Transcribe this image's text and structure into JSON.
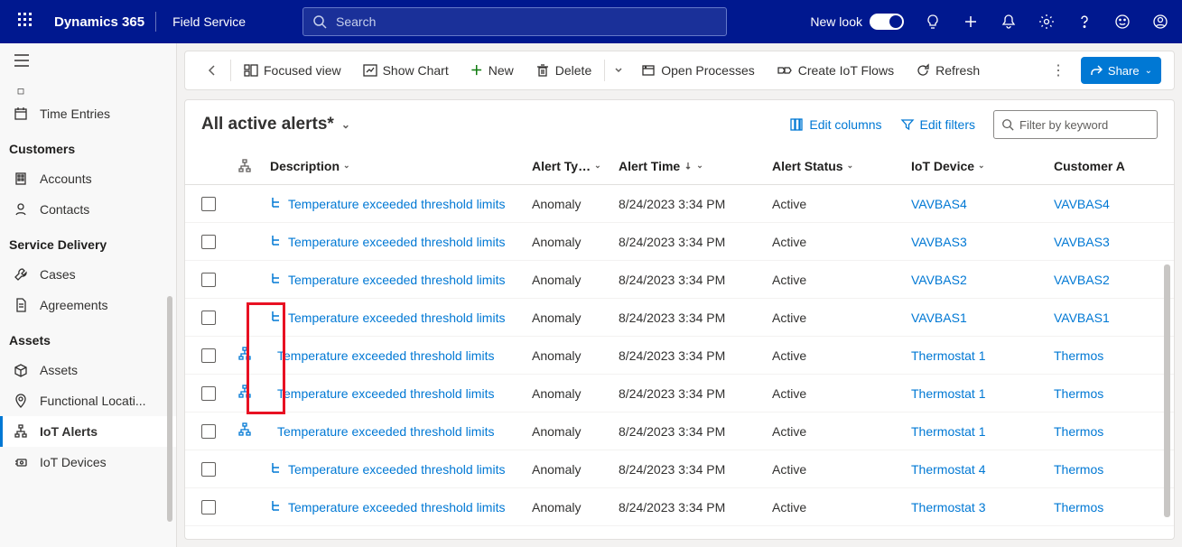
{
  "topbar": {
    "brand": "Dynamics 365",
    "app": "Field Service",
    "search_placeholder": "Search",
    "newlook": "New look"
  },
  "nav": {
    "sections": [
      {
        "heading": "",
        "items": [
          {
            "label": "",
            "icon": ""
          },
          {
            "label": "Time Entries",
            "icon": "calendar"
          }
        ]
      },
      {
        "heading": "Customers",
        "items": [
          {
            "label": "Accounts",
            "icon": "building"
          },
          {
            "label": "Contacts",
            "icon": "person"
          }
        ]
      },
      {
        "heading": "Service Delivery",
        "items": [
          {
            "label": "Cases",
            "icon": "wrench"
          },
          {
            "label": "Agreements",
            "icon": "document"
          }
        ]
      },
      {
        "heading": "Assets",
        "items": [
          {
            "label": "Assets",
            "icon": "box"
          },
          {
            "label": "Functional Locati...",
            "icon": "location"
          },
          {
            "label": "IoT Alerts",
            "icon": "iot",
            "selected": true
          },
          {
            "label": "IoT Devices",
            "icon": "chip"
          }
        ]
      }
    ]
  },
  "commands": {
    "focused_view": "Focused view",
    "show_chart": "Show Chart",
    "new": "New",
    "delete": "Delete",
    "open_processes": "Open Processes",
    "create_iot_flows": "Create IoT Flows",
    "refresh": "Refresh",
    "share": "Share"
  },
  "view": {
    "title": "All active alerts*",
    "edit_columns": "Edit columns",
    "edit_filters": "Edit filters",
    "filter_placeholder": "Filter by keyword"
  },
  "columns": {
    "description": "Description",
    "alert_type": "Alert Ty…",
    "alert_time": "Alert Time",
    "alert_status": "Alert Status",
    "iot_device": "IoT Device",
    "customer": "Customer A"
  },
  "rows": [
    {
      "tree": false,
      "indent": true,
      "desc": "Temperature exceeded threshold limits",
      "type": "Anomaly",
      "time": "8/24/2023 3:34 PM",
      "status": "Active",
      "device": "VAVBAS4",
      "cust": "VAVBAS4"
    },
    {
      "tree": false,
      "indent": true,
      "desc": "Temperature exceeded threshold limits",
      "type": "Anomaly",
      "time": "8/24/2023 3:34 PM",
      "status": "Active",
      "device": "VAVBAS3",
      "cust": "VAVBAS3"
    },
    {
      "tree": false,
      "indent": true,
      "desc": "Temperature exceeded threshold limits",
      "type": "Anomaly",
      "time": "8/24/2023 3:34 PM",
      "status": "Active",
      "device": "VAVBAS2",
      "cust": "VAVBAS2"
    },
    {
      "tree": false,
      "indent": true,
      "desc": "Temperature exceeded threshold limits",
      "type": "Anomaly",
      "time": "8/24/2023 3:34 PM",
      "status": "Active",
      "device": "VAVBAS1",
      "cust": "VAVBAS1"
    },
    {
      "tree": true,
      "indent": false,
      "desc": "Temperature exceeded threshold limits",
      "type": "Anomaly",
      "time": "8/24/2023 3:34 PM",
      "status": "Active",
      "device": "Thermostat 1",
      "cust": "Thermos"
    },
    {
      "tree": true,
      "indent": false,
      "desc": "Temperature exceeded threshold limits",
      "type": "Anomaly",
      "time": "8/24/2023 3:34 PM",
      "status": "Active",
      "device": "Thermostat 1",
      "cust": "Thermos"
    },
    {
      "tree": true,
      "indent": false,
      "desc": "Temperature exceeded threshold limits",
      "type": "Anomaly",
      "time": "8/24/2023 3:34 PM",
      "status": "Active",
      "device": "Thermostat 1",
      "cust": "Thermos"
    },
    {
      "tree": false,
      "indent": true,
      "desc": "Temperature exceeded threshold limits",
      "type": "Anomaly",
      "time": "8/24/2023 3:34 PM",
      "status": "Active",
      "device": "Thermostat 4",
      "cust": "Thermos"
    },
    {
      "tree": false,
      "indent": true,
      "desc": "Temperature exceeded threshold limits",
      "type": "Anomaly",
      "time": "8/24/2023 3:34 PM",
      "status": "Active",
      "device": "Thermostat 3",
      "cust": "Thermos"
    }
  ]
}
